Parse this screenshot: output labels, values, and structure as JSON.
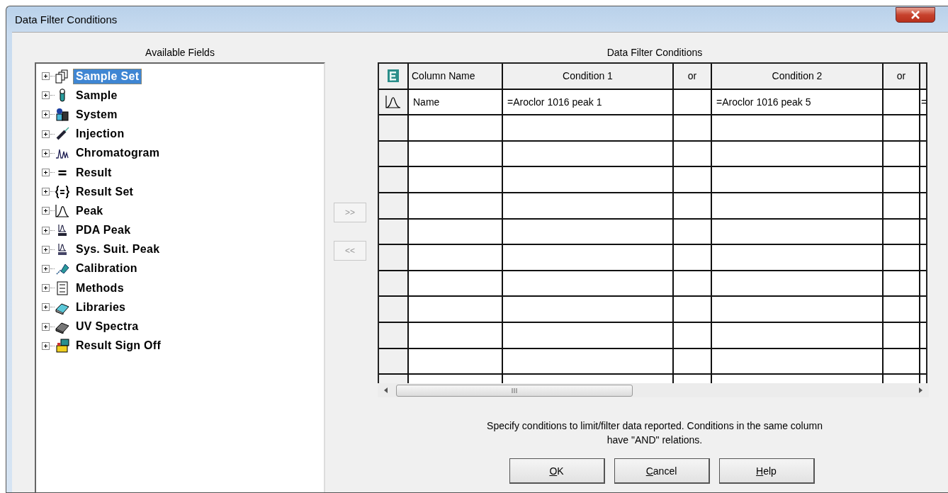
{
  "window": {
    "title": "Data Filter Conditions"
  },
  "available_fields": {
    "label": "Available Fields",
    "items": [
      {
        "label": "Sample Set",
        "selected": true,
        "expanded": false
      },
      {
        "label": "Sample",
        "selected": false,
        "expanded": false
      },
      {
        "label": "System",
        "selected": false,
        "expanded": false
      },
      {
        "label": "Injection",
        "selected": false,
        "expanded": false
      },
      {
        "label": "Chromatogram",
        "selected": false,
        "expanded": false
      },
      {
        "label": "Result",
        "selected": false,
        "expanded": false
      },
      {
        "label": "Result Set",
        "selected": false,
        "expanded": false
      },
      {
        "label": "Peak",
        "selected": false,
        "expanded": false
      },
      {
        "label": "PDA Peak",
        "selected": false,
        "expanded": false
      },
      {
        "label": "Sys. Suit. Peak",
        "selected": false,
        "expanded": false
      },
      {
        "label": "Calibration",
        "selected": false,
        "expanded": false
      },
      {
        "label": "Methods",
        "selected": false,
        "expanded": false
      },
      {
        "label": "Libraries",
        "selected": false,
        "expanded": false
      },
      {
        "label": "UV Spectra",
        "selected": false,
        "expanded": false
      },
      {
        "label": "Result Sign Off",
        "selected": false,
        "expanded": false
      }
    ]
  },
  "move_buttons": [
    {
      "label": ">>",
      "disabled": true
    },
    {
      "label": "<<",
      "disabled": true
    }
  ],
  "conditions": {
    "label": "Data Filter Conditions",
    "columns": [
      "Column Name",
      "Condition 1",
      "or",
      "Condition 2",
      "or"
    ],
    "rows": [
      [
        "Name",
        "=Aroclor 1016 peak 1",
        "",
        "=Aroclor 1016 peak 5",
        "",
        "="
      ]
    ]
  },
  "note": "Specify conditions to limit/filter data reported. Conditions in the same column have \"AND\" relations.",
  "buttons": [
    {
      "label": "OK"
    },
    {
      "label": "Cancel"
    },
    {
      "label": "Help"
    }
  ]
}
